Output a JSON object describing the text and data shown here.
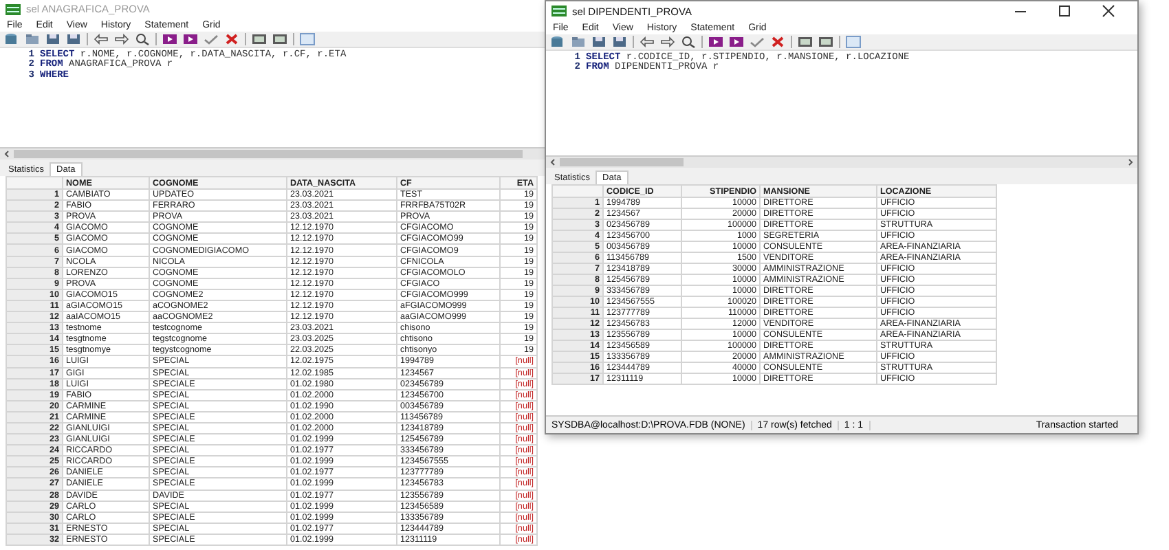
{
  "windows": [
    {
      "title": "sel ANAGRAFICA_PROVA",
      "active": false,
      "menu": [
        "File",
        "Edit",
        "View",
        "History",
        "Statement",
        "Grid"
      ],
      "sql": [
        {
          "number": "1",
          "keyword": "SELECT",
          "rest": " r.NOME, r.COGNOME, r.DATA_NASCITA, r.CF, r.ETA"
        },
        {
          "number": "2",
          "keyword": "FROM",
          "rest": " ANAGRAFICA_PROVA r"
        },
        {
          "number": "3",
          "keyword": "WHERE"
        }
      ],
      "tabs": [
        {
          "label": "Statistics",
          "selected": false
        },
        {
          "label": "Data",
          "selected": true
        }
      ],
      "columns": [
        {
          "label": "NOME",
          "numeric": false
        },
        {
          "label": "COGNOME",
          "numeric": false
        },
        {
          "label": "DATA_NASCITA",
          "numeric": false
        },
        {
          "label": "CF",
          "numeric": false
        },
        {
          "label": "ETA",
          "numeric": true
        }
      ],
      "rows": [
        {
          "number": "1",
          "cells": [
            "CAMBIATO",
            "UPDATEO",
            "23.03.2021",
            "TEST",
            "19"
          ],
          "last_null": false
        },
        {
          "number": "2",
          "cells": [
            "FABIO",
            "FERRARO",
            "23.03.2021",
            "FRRFBA75T02R",
            "19"
          ],
          "last_null": false
        },
        {
          "number": "3",
          "cells": [
            "PROVA",
            "PROVA",
            "23.03.2021",
            "PROVA",
            "19"
          ],
          "last_null": false
        },
        {
          "number": "4",
          "cells": [
            "GIACOMO",
            "COGNOME",
            "12.12.1970",
            "CFGIACOMO",
            "19"
          ],
          "last_null": false
        },
        {
          "number": "5",
          "cells": [
            "GIACOMO",
            "COGNOME",
            "12.12.1970",
            "CFGIACOMO99",
            "19"
          ],
          "last_null": false
        },
        {
          "number": "6",
          "cells": [
            "GIACOMO",
            "COGNOMEDIGIACOMO",
            "12.12.1970",
            "CFGIACOMO9",
            "19"
          ],
          "last_null": false
        },
        {
          "number": "7",
          "cells": [
            "NCOLA",
            "NICOLA",
            "12.12.1970",
            "CFNICOLA",
            "19"
          ],
          "last_null": false
        },
        {
          "number": "8",
          "cells": [
            "LORENZO",
            "COGNOME",
            "12.12.1970",
            "CFGIACOMOLO",
            "19"
          ],
          "last_null": false
        },
        {
          "number": "9",
          "cells": [
            "PROVA",
            "COGNOME",
            "12.12.1970",
            "CFGIACO",
            "19"
          ],
          "last_null": false
        },
        {
          "number": "10",
          "cells": [
            "GIACOMO15",
            "COGNOME2",
            "12.12.1970",
            "CFGIACOMO999",
            "19"
          ],
          "last_null": false
        },
        {
          "number": "11",
          "cells": [
            "aGIACOMO15",
            "aCOGNOME2",
            "12.12.1970",
            "aFGIACOMO999",
            "19"
          ],
          "last_null": false
        },
        {
          "number": "12",
          "cells": [
            "aaIACOMO15",
            "aaCOGNOME2",
            "12.12.1970",
            "aaGIACOMO999",
            "19"
          ],
          "last_null": false
        },
        {
          "number": "13",
          "cells": [
            "testnome",
            "testcognome",
            "23.03.2021",
            "chisono",
            "19"
          ],
          "last_null": false
        },
        {
          "number": "14",
          "cells": [
            "tesgtnome",
            "tegstcognome",
            "23.03.2025",
            "chtisono",
            "19"
          ],
          "last_null": false
        },
        {
          "number": "15",
          "cells": [
            "tesgtnomye",
            "tegystcognome",
            "22.03.2025",
            "chtisonyo",
            "19"
          ],
          "last_null": false
        },
        {
          "number": "16",
          "cells": [
            "LUIGI",
            "SPECIAL",
            "12.02.1975",
            "1994789",
            "[null]"
          ],
          "last_null": true
        },
        {
          "number": "17",
          "cells": [
            "GIGI",
            "SPECIAL",
            "12.02.1985",
            "1234567",
            "[null]"
          ],
          "last_null": true
        },
        {
          "number": "18",
          "cells": [
            "LUIGI",
            "SPECIALE",
            "01.02.1980",
            "023456789",
            "[null]"
          ],
          "last_null": true
        },
        {
          "number": "19",
          "cells": [
            "FABIO",
            "SPECIAL",
            "01.02.2000",
            "123456700",
            "[null]"
          ],
          "last_null": true
        },
        {
          "number": "20",
          "cells": [
            "CARMINE",
            "SPECIAL",
            "01.02.1990",
            "003456789",
            "[null]"
          ],
          "last_null": true
        },
        {
          "number": "21",
          "cells": [
            "CARMINE",
            "SPECIALE",
            "01.02.2000",
            "113456789",
            "[null]"
          ],
          "last_null": true
        },
        {
          "number": "22",
          "cells": [
            "GIANLUIGI",
            "SPECIAL",
            "01.02.2000",
            "123418789",
            "[null]"
          ],
          "last_null": true
        },
        {
          "number": "23",
          "cells": [
            "GIANLUIGI",
            "SPECIALE",
            "01.02.1999",
            "125456789",
            "[null]"
          ],
          "last_null": true
        },
        {
          "number": "24",
          "cells": [
            "RICCARDO",
            "SPECIAL",
            "01.02.1977",
            "333456789",
            "[null]"
          ],
          "last_null": true
        },
        {
          "number": "25",
          "cells": [
            "RICCARDO",
            "SPECIALE",
            "01.02.1999",
            "1234567555",
            "[null]"
          ],
          "last_null": true
        },
        {
          "number": "26",
          "cells": [
            "DANIELE",
            "SPECIAL",
            "01.02.1977",
            "123777789",
            "[null]"
          ],
          "last_null": true
        },
        {
          "number": "27",
          "cells": [
            "DANIELE",
            "SPECIALE",
            "01.02.1999",
            "123456783",
            "[null]"
          ],
          "last_null": true
        },
        {
          "number": "28",
          "cells": [
            "DAVIDE",
            "DAVIDE",
            "01.02.1977",
            "123556789",
            "[null]"
          ],
          "last_null": true
        },
        {
          "number": "29",
          "cells": [
            "CARLO",
            "SPECIAL",
            "01.02.1999",
            "123456589",
            "[null]"
          ],
          "last_null": true
        },
        {
          "number": "30",
          "cells": [
            "CARLO",
            "SPECIALE",
            "01.02.1999",
            "133356789",
            "[null]"
          ],
          "last_null": true
        },
        {
          "number": "31",
          "cells": [
            "ERNESTO",
            "SPECIAL",
            "01.02.1977",
            "123444789",
            "[null]"
          ],
          "last_null": true
        },
        {
          "number": "32",
          "cells": [
            "ERNESTO",
            "SPECIALE",
            "01.02.1999",
            "12311119",
            "[null]"
          ],
          "last_null": true
        }
      ]
    },
    {
      "title": "sel DIPENDENTI_PROVA",
      "active": true,
      "menu": [
        "File",
        "Edit",
        "View",
        "History",
        "Statement",
        "Grid"
      ],
      "sql": [
        {
          "number": "1",
          "keyword": "SELECT",
          "rest": " r.CODICE_ID, r.STIPENDIO, r.MANSIONE, r.LOCAZIONE"
        },
        {
          "number": "2",
          "keyword": "FROM",
          "rest": " DIPENDENTI_PROVA r"
        }
      ],
      "tabs": [
        {
          "label": "Statistics",
          "selected": false
        },
        {
          "label": "Data",
          "selected": true
        }
      ],
      "columns": [
        {
          "label": "CODICE_ID",
          "numeric": false
        },
        {
          "label": "STIPENDIO",
          "numeric": true
        },
        {
          "label": "MANSIONE",
          "numeric": false
        },
        {
          "label": "LOCAZIONE",
          "numeric": false
        }
      ],
      "rows": [
        {
          "number": "1",
          "cells": [
            "1994789",
            "10000",
            "DIRETTORE",
            "UFFICIO"
          ],
          "last_null": false
        },
        {
          "number": "2",
          "cells": [
            "1234567",
            "20000",
            "DIRETTORE",
            "UFFICIO"
          ],
          "last_null": false
        },
        {
          "number": "3",
          "cells": [
            "023456789",
            "100000",
            "DIRETTORE",
            "STRUTTURA"
          ],
          "last_null": false
        },
        {
          "number": "4",
          "cells": [
            "123456700",
            "1000",
            "SEGRETERIA",
            "UFFICIO"
          ],
          "last_null": false
        },
        {
          "number": "5",
          "cells": [
            "003456789",
            "10000",
            "CONSULENTE",
            "AREA-FINANZIARIA"
          ],
          "last_null": false
        },
        {
          "number": "6",
          "cells": [
            "113456789",
            "1500",
            "VENDITORE",
            "AREA-FINANZIARIA"
          ],
          "last_null": false
        },
        {
          "number": "7",
          "cells": [
            "123418789",
            "30000",
            "AMMINISTRAZIONE",
            "UFFICIO"
          ],
          "last_null": false
        },
        {
          "number": "8",
          "cells": [
            "125456789",
            "10000",
            "AMMINISTRAZIONE",
            "UFFICIO"
          ],
          "last_null": false
        },
        {
          "number": "9",
          "cells": [
            "333456789",
            "10000",
            "DIRETTORE",
            "UFFICIO"
          ],
          "last_null": false
        },
        {
          "number": "10",
          "cells": [
            "1234567555",
            "100020",
            "DIRETTORE",
            "UFFICIO"
          ],
          "last_null": false
        },
        {
          "number": "11",
          "cells": [
            "123777789",
            "110000",
            "DIRETTORE",
            "UFFICIO"
          ],
          "last_null": false
        },
        {
          "number": "12",
          "cells": [
            "123456783",
            "12000",
            "VENDITORE",
            "AREA-FINANZIARIA"
          ],
          "last_null": false
        },
        {
          "number": "13",
          "cells": [
            "123556789",
            "10000",
            "CONSULENTE",
            "AREA-FINANZIARIA"
          ],
          "last_null": false
        },
        {
          "number": "14",
          "cells": [
            "123456589",
            "100000",
            "DIRETTORE",
            "STRUTTURA"
          ],
          "last_null": false
        },
        {
          "number": "15",
          "cells": [
            "133356789",
            "20000",
            "AMMINISTRAZIONE",
            "UFFICIO"
          ],
          "last_null": false
        },
        {
          "number": "16",
          "cells": [
            "123444789",
            "40000",
            "CONSULENTE",
            "STRUTTURA"
          ],
          "last_null": false
        },
        {
          "number": "17",
          "cells": [
            "12311119",
            "10000",
            "DIRETTORE",
            "UFFICIO"
          ],
          "last_null": false
        }
      ],
      "status_bar": [
        "SYSDBA@localhost:D:\\PROVA.FDB (NONE)",
        "17 row(s) fetched",
        "1 : 1",
        "Transaction started"
      ]
    }
  ]
}
